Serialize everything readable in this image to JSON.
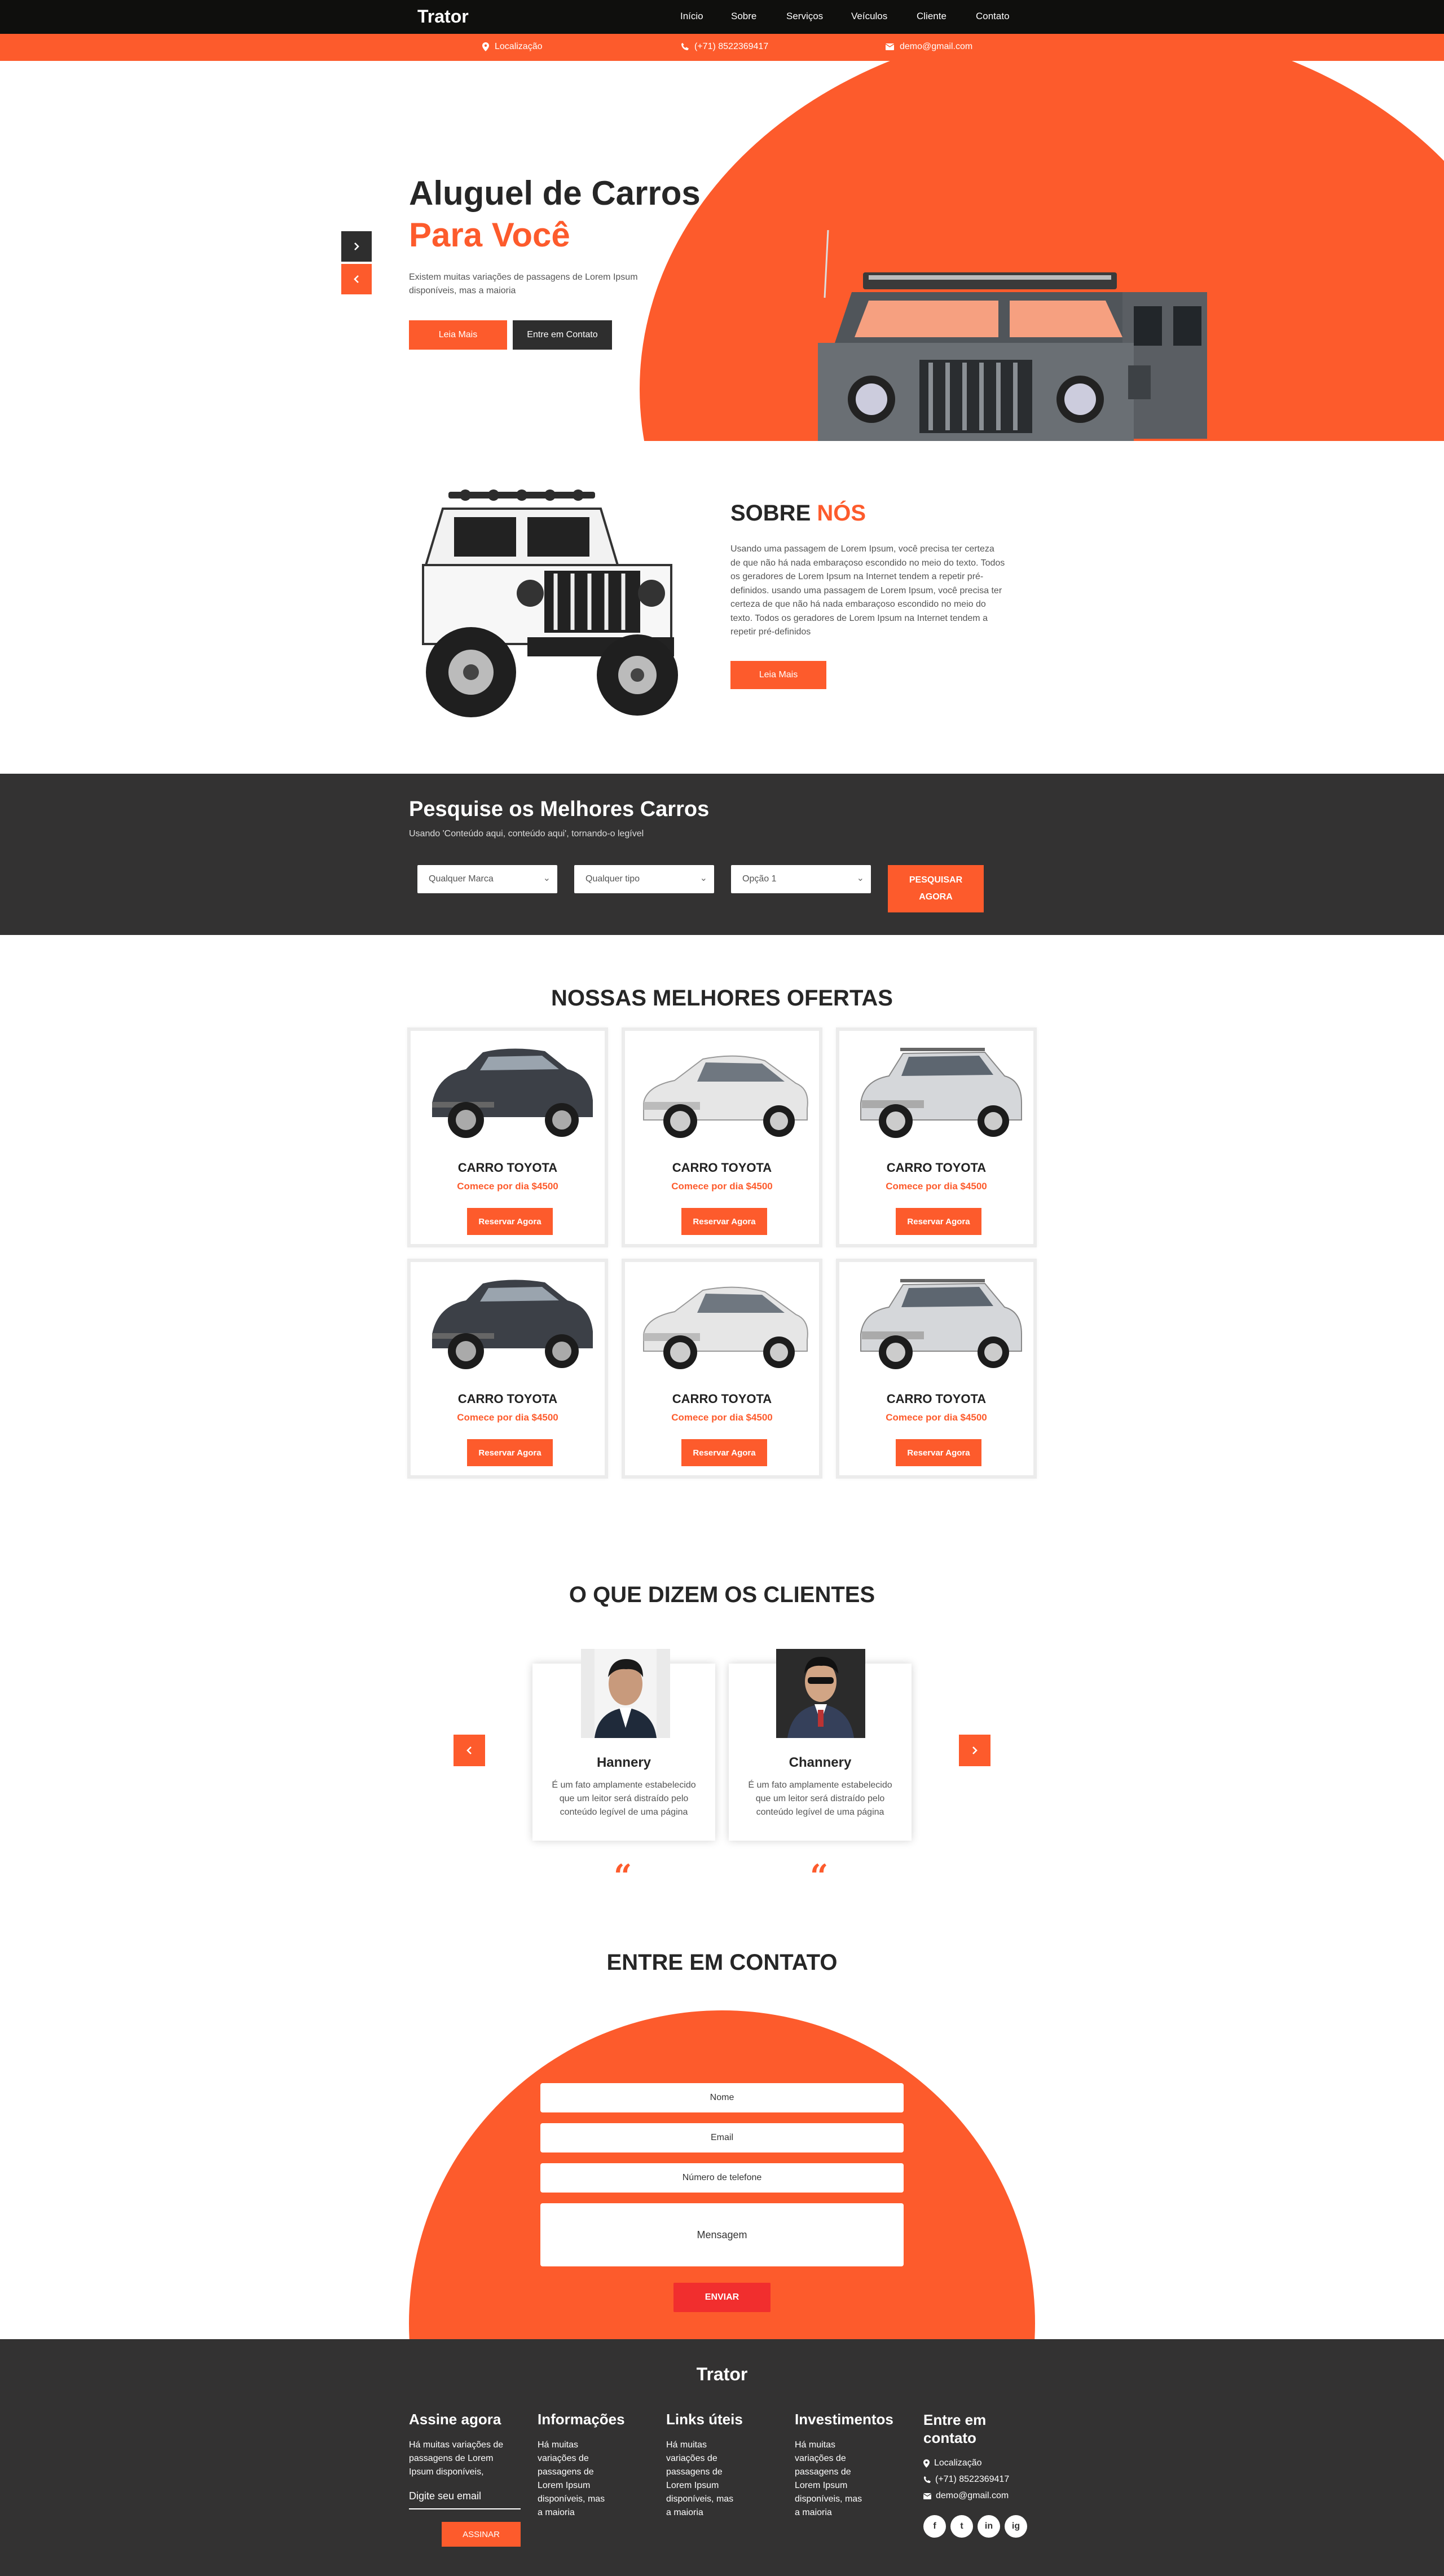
{
  "brand": "Trator",
  "nav": [
    "Início",
    "Sobre",
    "Serviços",
    "Veículos",
    "Cliente",
    "Contato"
  ],
  "topbar": {
    "location": "Localização",
    "phone": "(+71) 8522369417",
    "email": "demo@gmail.com"
  },
  "hero": {
    "title_line1": "Aluguel de Carros",
    "title_line2": "Para Você",
    "text": "Existem muitas variações de passagens de Lorem Ipsum disponíveis, mas a maioria",
    "read_more": "Leia Mais",
    "contact": "Entre em Contato"
  },
  "about": {
    "title_a": "SOBRE",
    "title_b": "NÓS",
    "text": "Usando uma passagem de Lorem Ipsum, você precisa ter certeza de que não há nada embaraçoso escondido no meio do texto. Todos os geradores de Lorem Ipsum na Internet tendem a repetir pré-definidos. usando uma passagem de Lorem Ipsum, você precisa ter certeza de que não há nada embaraçoso escondido no meio do texto. Todos os geradores de Lorem Ipsum na Internet tendem a repetir pré-definidos",
    "button": "Leia Mais"
  },
  "search": {
    "title": "Pesquise os Melhores Carros",
    "subtitle": "Usando 'Conteúdo aqui, conteúdo aqui', tornando-o legível",
    "brand_select": "Qualquer Marca",
    "type_select": "Qualquer tipo",
    "option_select": "Opção 1",
    "button_line1": "PESQUISAR",
    "button_line2": "AGORA"
  },
  "offers": {
    "title": "NOSSAS MELHORES OFERTAS",
    "cards": [
      {
        "title": "CARRO TOYOTA",
        "price": "Comece por dia $4500",
        "button": "Reservar Agora"
      },
      {
        "title": "CARRO TOYOTA",
        "price": "Comece por dia $4500",
        "button": "Reservar Agora"
      },
      {
        "title": "CARRO TOYOTA",
        "price": "Comece por dia $4500",
        "button": "Reservar Agora"
      },
      {
        "title": "CARRO TOYOTA",
        "price": "Comece por dia $4500",
        "button": "Reservar Agora"
      },
      {
        "title": "CARRO TOYOTA",
        "price": "Comece por dia $4500",
        "button": "Reservar Agora"
      },
      {
        "title": "CARRO TOYOTA",
        "price": "Comece por dia $4500",
        "button": "Reservar Agora"
      }
    ]
  },
  "clients": {
    "title": "O QUE DIZEM OS CLIENTES",
    "items": [
      {
        "name": "Hannery",
        "text": "É um fato amplamente estabelecido que um leitor será distraído pelo conteúdo legível de uma página"
      },
      {
        "name": "Channery",
        "text": "É um fato amplamente estabelecido que um leitor será distraído pelo conteúdo legível de uma página"
      }
    ]
  },
  "contact": {
    "title": "ENTRE EM CONTATO",
    "name": "Nome",
    "email": "Email",
    "phone": "Número de telefone",
    "message": "Mensagem",
    "send": "ENVIAR"
  },
  "footer": {
    "brand": "Trator",
    "subscribe_title": "Assine agora",
    "subscribe_text": "Há muitas variações de passagens de Lorem Ipsum disponíveis,",
    "subscribe_placeholder": "Digite seu email",
    "subscribe_button": "ASSINAR",
    "info_title": "Informações",
    "info_text": "Há muitas variações de passagens de Lorem Ipsum disponíveis, mas a maioria",
    "links_title": "Links úteis",
    "links_text": "Há muitas variações de passagens de Lorem Ipsum disponíveis, mas a maioria",
    "invest_title": "Investimentos",
    "invest_text": "Há muitas variações de passagens de Lorem Ipsum disponíveis, mas a maioria",
    "contact_title": "Entre em contato",
    "location": "Localização",
    "phone": "(+71) 8522369417",
    "email": "demo@gmail.com",
    "social": [
      "f",
      "t",
      "in",
      "ig"
    ]
  },
  "colors": {
    "accent": "#fd5b2c",
    "dark": "#333232",
    "nav": "#0f0f0d"
  }
}
